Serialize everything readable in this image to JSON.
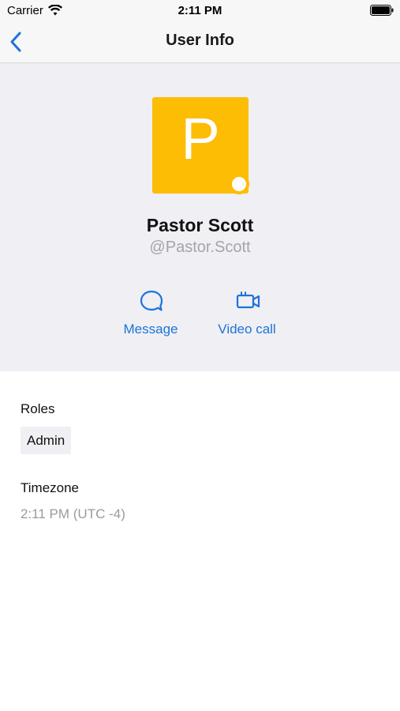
{
  "status_bar": {
    "carrier": "Carrier",
    "time": "2:11 PM",
    "wifi_icon": "wifi-icon",
    "battery_icon": "battery-icon"
  },
  "nav": {
    "title": "User Info",
    "back_icon": "chevron-left-icon"
  },
  "profile": {
    "avatar_letter": "P",
    "avatar_color": "#fdbd05",
    "name": "Pastor Scott",
    "handle": "@Pastor.Scott",
    "status_indicator": "status-dot"
  },
  "actions": {
    "message": {
      "label": "Message",
      "icon": "message-bubble-icon"
    },
    "video_call": {
      "label": "Video call",
      "icon": "video-camera-icon"
    },
    "accent_color": "#1d74d8"
  },
  "info": {
    "roles_label": "Roles",
    "roles": [
      "Admin"
    ],
    "timezone_label": "Timezone",
    "timezone_value": "2:11 PM (UTC -4)"
  }
}
